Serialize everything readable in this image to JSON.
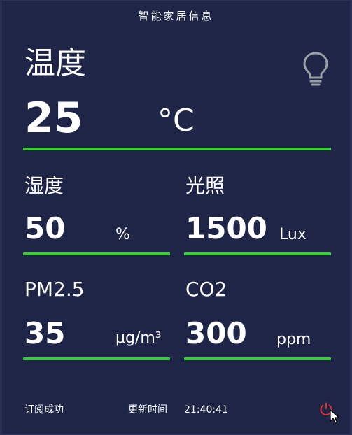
{
  "header": {
    "title": "智能家居信息"
  },
  "temperature": {
    "label": "温度",
    "value": "25",
    "unit": "°C"
  },
  "humidity": {
    "label": "湿度",
    "value": "50",
    "unit": "%"
  },
  "light": {
    "label": "光照",
    "value": "1500",
    "unit": "Lux"
  },
  "pm25": {
    "label": "PM2.5",
    "value": "35",
    "unit": "μg/m³"
  },
  "co2": {
    "label": "CO2",
    "value": "300",
    "unit": "ppm"
  },
  "footer": {
    "status": "订阅成功",
    "update_label": "更新时间",
    "update_time": "21:40:41"
  },
  "colors": {
    "background": "#1f2547",
    "accent_line": "#3fcc3a",
    "power_icon": "#e0302d",
    "bulb_icon": "#9aa0a6"
  },
  "icons": {
    "bulb": "lightbulb-icon",
    "power": "power-icon",
    "cursor": "mouse-cursor-icon"
  }
}
